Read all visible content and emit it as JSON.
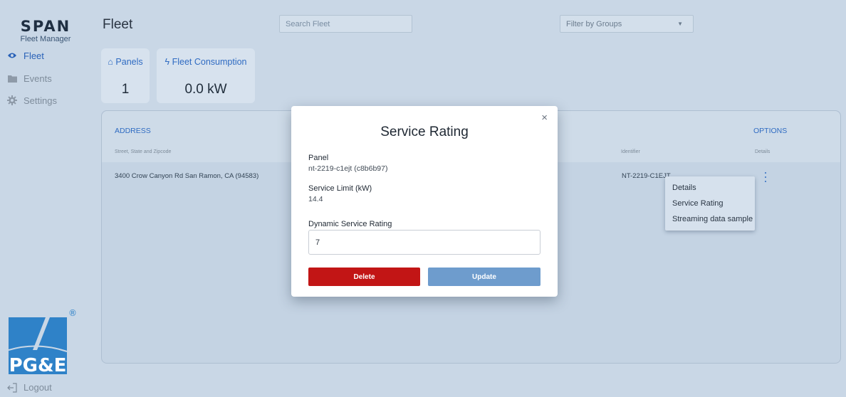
{
  "brand": {
    "logo": "SPAN",
    "subtitle": "Fleet Manager"
  },
  "nav": [
    {
      "label": "Fleet",
      "icon": "eye-icon",
      "active": true
    },
    {
      "label": "Events",
      "icon": "folder-icon",
      "active": false
    },
    {
      "label": "Settings",
      "icon": "gear-icon",
      "active": false
    }
  ],
  "footer": {
    "logout_label": "Logout",
    "partner_logo_text": "PG&E",
    "registered_mark": "®"
  },
  "header": {
    "title": "Fleet",
    "search_placeholder": "Search Fleet",
    "filter_label": "Filter by Groups"
  },
  "stats": [
    {
      "label": "Panels",
      "icon": "home-icon",
      "value": "1"
    },
    {
      "label": "Fleet Consumption",
      "icon": "bolt-icon",
      "value": "0.0 kW"
    }
  ],
  "table": {
    "columns": [
      {
        "title": "ADDRESS",
        "subtitle": "Street, State and Zipcode"
      },
      {
        "title": "",
        "subtitle": "Identifier"
      },
      {
        "title": "OPTIONS",
        "subtitle": "Details"
      }
    ],
    "rows": [
      {
        "address": "3400 Crow Canyon Rd San Ramon, CA (94583)",
        "identifier": "NT-2219-C1EJT"
      }
    ]
  },
  "options_menu": {
    "items": [
      "Details",
      "Service Rating",
      "Streaming data sample"
    ]
  },
  "modal": {
    "title": "Service Rating",
    "close_glyph": "×",
    "panel_label": "Panel",
    "panel_value": "nt-2219-c1ejt (c8b6b97)",
    "service_limit_label": "Service Limit (kW)",
    "service_limit_value": "14.4",
    "dsr_label": "Dynamic Service Rating",
    "dsr_value": "7",
    "delete_label": "Delete",
    "update_label": "Update"
  },
  "colors": {
    "accent": "#2f6bc2",
    "danger": "#c21515",
    "update": "#6e9ccd",
    "background": "#c9d7e6"
  }
}
